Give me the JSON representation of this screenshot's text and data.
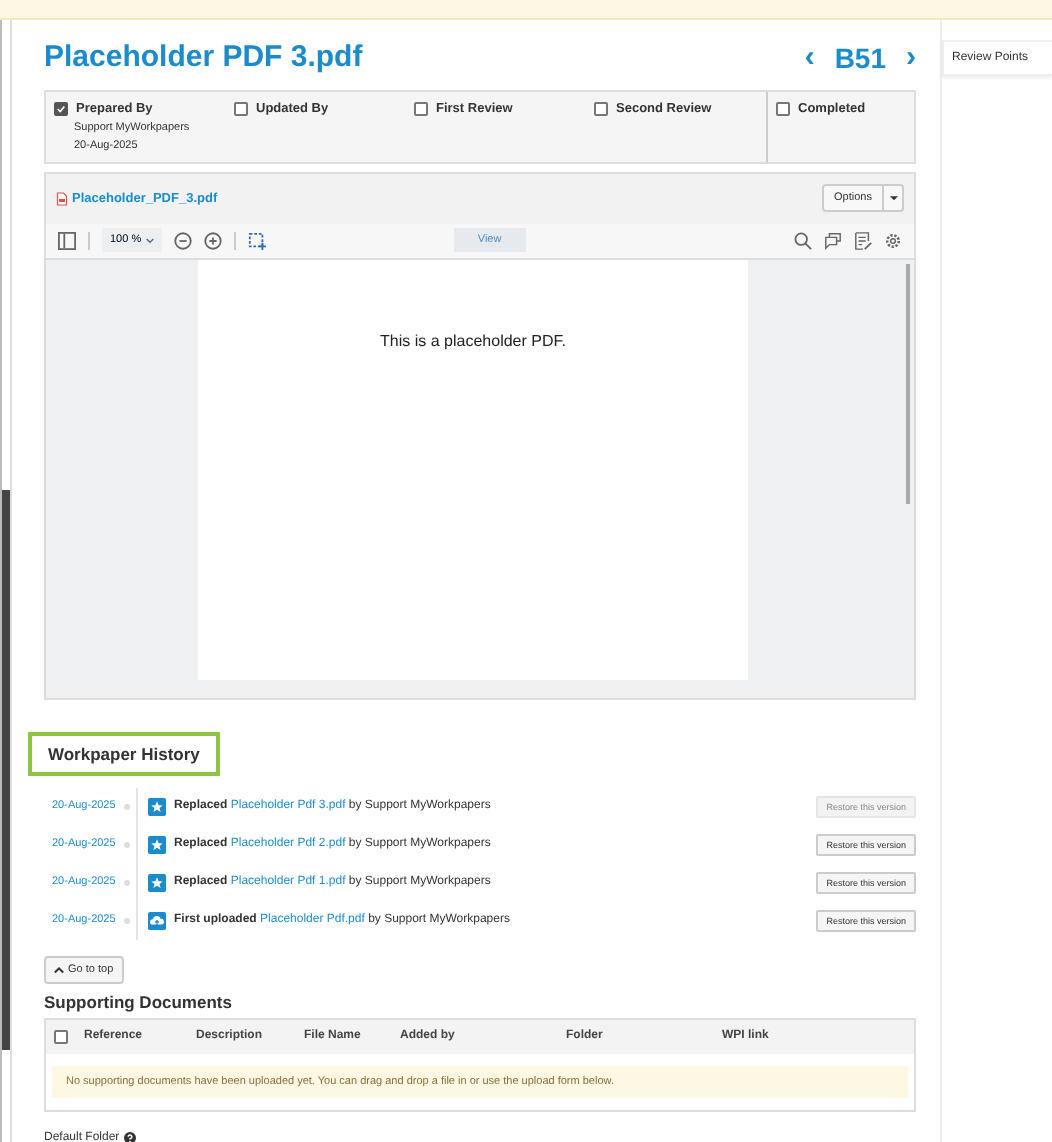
{
  "title": "Placeholder PDF 3.pdf",
  "nav": {
    "prev": "‹",
    "code": "B51",
    "next": "›"
  },
  "signoffs": [
    {
      "label": "Prepared By",
      "checked": true,
      "name": "Support MyWorkpapers",
      "date": "20-Aug-2025"
    },
    {
      "label": "Updated By",
      "checked": false
    },
    {
      "label": "First Review",
      "checked": false
    },
    {
      "label": "Second Review",
      "checked": false
    }
  ],
  "completed": {
    "label": "Completed",
    "checked": false
  },
  "viewer": {
    "file": "Placeholder_PDF_3.pdf",
    "options": "Options",
    "zoom": "100 %",
    "view_tab": "View",
    "page_text": "This is a placeholder PDF."
  },
  "history": {
    "title": "Workpaper History",
    "entries": [
      {
        "date": "20-Aug-2025",
        "kind": "replaced",
        "action": "Replaced",
        "file": "Placeholder Pdf 3.pdf",
        "by": "by Support MyWorkpapers",
        "button": "Restore this version",
        "disabled": true
      },
      {
        "date": "20-Aug-2025",
        "kind": "replaced",
        "action": "Replaced",
        "file": "Placeholder Pdf 2.pdf",
        "by": "by Support MyWorkpapers",
        "button": "Restore this version",
        "disabled": false
      },
      {
        "date": "20-Aug-2025",
        "kind": "replaced",
        "action": "Replaced",
        "file": "Placeholder Pdf 1.pdf",
        "by": "by Support MyWorkpapers",
        "button": "Restore this version",
        "disabled": false
      },
      {
        "date": "20-Aug-2025",
        "kind": "uploaded",
        "action": "First uploaded",
        "file": "Placeholder Pdf.pdf",
        "by": "by Support MyWorkpapers",
        "button": "Restore this version",
        "disabled": false
      }
    ]
  },
  "go_to_top": "Go to top",
  "supporting": {
    "title": "Supporting Documents",
    "all_checked": false,
    "columns": [
      "Reference",
      "Description",
      "File Name",
      "Added by",
      "Folder",
      "WPI link"
    ],
    "empty_message": "No supporting documents have been uploaded yet. You can drag and drop a file in or use the upload form below."
  },
  "default_folder": {
    "label": "Default Folder"
  },
  "side_tab": {
    "label": "Review Points",
    "selected": true
  }
}
